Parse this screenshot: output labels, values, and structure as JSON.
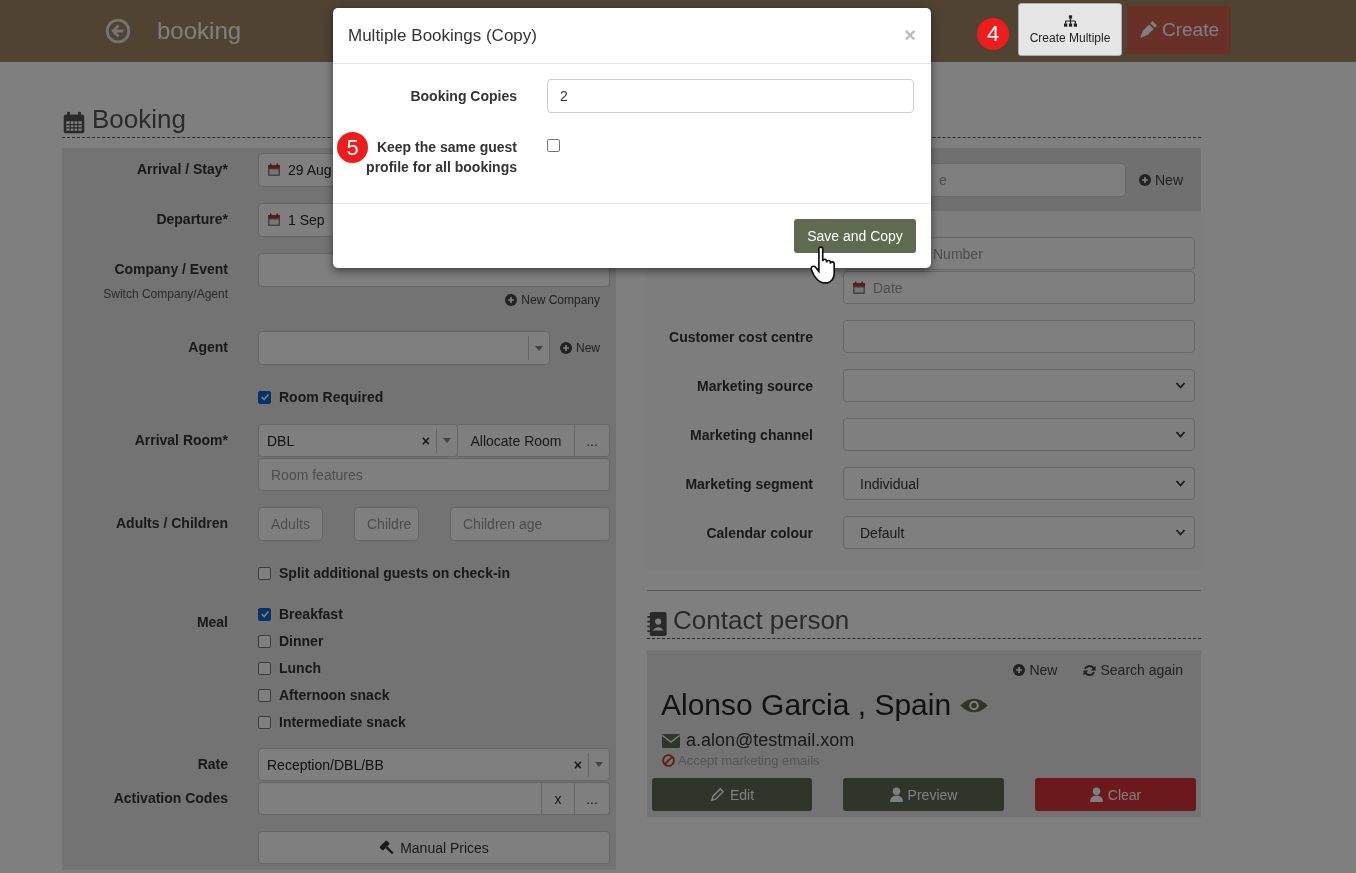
{
  "header": {
    "title": "booking",
    "buttons": [
      {
        "kind": "multiple",
        "label": "Create Multiple",
        "step": "4"
      },
      {
        "kind": "create",
        "label": "Create"
      }
    ]
  },
  "booking": {
    "heading": "Booking",
    "rows": [
      {
        "kind": "date",
        "label": "Arrival / Stay*",
        "value": "29 Aug"
      },
      {
        "kind": "date",
        "label": "Departure*",
        "value": "1 Sep"
      },
      {
        "kind": "company",
        "label": "Company / Event",
        "sublabel": "Switch Company/Agent",
        "link": "New Company"
      },
      {
        "kind": "agent",
        "label": "Agent",
        "link": "New"
      },
      {
        "kind": "checkbox",
        "text": "Room Required",
        "checked": true
      },
      {
        "kind": "room",
        "label": "Arrival Room*",
        "value": "DBL",
        "clear": "×",
        "action": "Allocate Room",
        "more": "...",
        "placeholder": "Room features"
      },
      {
        "kind": "counts",
        "label": "Adults / Children",
        "placeholders": [
          "Adults",
          "Childre",
          "Children age"
        ]
      },
      {
        "kind": "checkbox",
        "text": "Split additional guests on check-in",
        "checked": false
      },
      {
        "kind": "checklist",
        "label": "Meal",
        "options": [
          {
            "text": "Breakfast",
            "checked": true
          },
          {
            "text": "Dinner",
            "checked": false
          },
          {
            "text": "Lunch",
            "checked": false
          },
          {
            "text": "Afternoon snack",
            "checked": false
          },
          {
            "text": "Intermediate snack",
            "checked": false
          }
        ]
      },
      {
        "kind": "rate",
        "label": "Rate",
        "value": "Reception/DBL/BB",
        "clear": "×"
      },
      {
        "kind": "codes",
        "label": "Activation Codes",
        "buttons": [
          "x",
          "..."
        ]
      },
      {
        "kind": "button",
        "text": "Manual Prices"
      }
    ]
  },
  "guest": {
    "search_placeholder": "e",
    "link": "New",
    "fields": [
      {
        "kind": "text",
        "placeholder": "Number"
      },
      {
        "kind": "date",
        "placeholder": "Date"
      },
      {
        "kind": "text",
        "label": "Customer cost centre"
      },
      {
        "kind": "select",
        "label": "Marketing source"
      },
      {
        "kind": "select",
        "label": "Marketing channel"
      },
      {
        "kind": "select",
        "label": "Marketing segment",
        "value": "Individual"
      },
      {
        "kind": "select",
        "label": "Calendar colour",
        "value": "Default"
      }
    ]
  },
  "contact": {
    "heading": "Contact person",
    "links": [
      {
        "kind": "new",
        "label": "New"
      },
      {
        "kind": "search",
        "label": "Search again"
      }
    ],
    "name": "Alonso Garcia , Spain",
    "email": "a.alon@testmail.xom",
    "marketing": "Accept marketing emails",
    "marketing_accepted": false,
    "buttons": [
      {
        "kind": "edit",
        "label": "Edit"
      },
      {
        "kind": "preview",
        "label": "Preview"
      },
      {
        "kind": "clear",
        "label": "Clear"
      }
    ]
  },
  "modal": {
    "title": "Multiple Bookings (Copy)",
    "close": "×",
    "fields": [
      {
        "kind": "number",
        "label": "Booking Copies",
        "value": "2"
      },
      {
        "kind": "checkbox",
        "label": "Keep the same guest profile for all bookings",
        "checked": false,
        "step": "5"
      }
    ],
    "button": "Save and Copy"
  }
}
